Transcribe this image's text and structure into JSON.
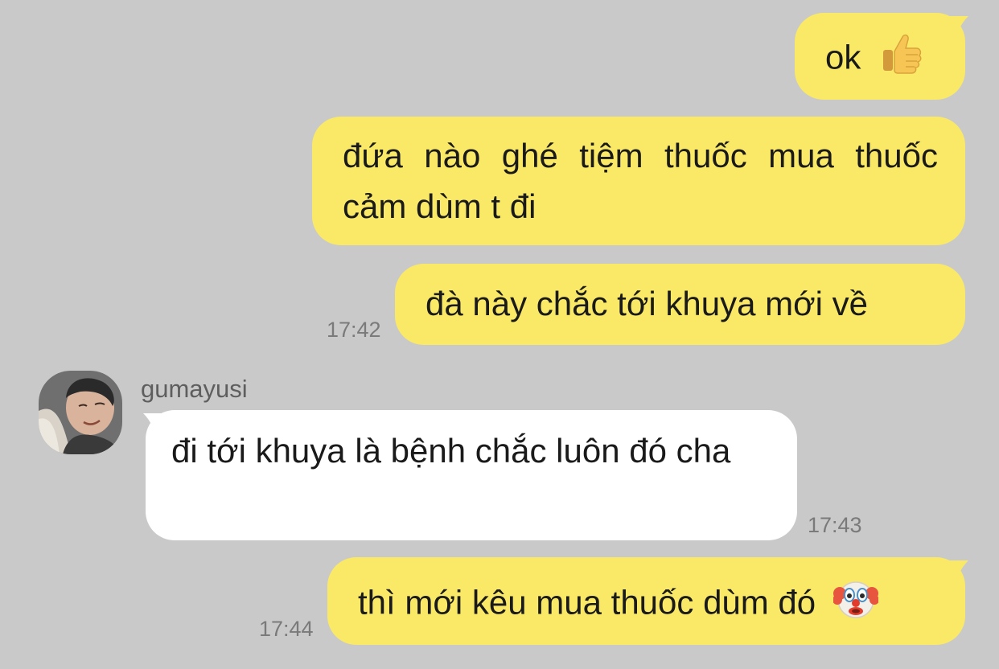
{
  "colors": {
    "background": "#c9c9c9",
    "outgoing_bubble": "#fae967",
    "incoming_bubble": "#ffffff",
    "timestamp": "#7a7a7a"
  },
  "messages": [
    {
      "direction": "outgoing",
      "text": "ok",
      "emoji": "thumbs-up-icon"
    },
    {
      "direction": "outgoing",
      "text": "đứa nào ghé tiệm thuốc mua thuốc cảm dùm t đi"
    },
    {
      "direction": "outgoing",
      "text": "đà này chắc tới khuya mới về",
      "time": "17:42"
    },
    {
      "direction": "incoming",
      "sender": "gumayusi",
      "avatar": "avatar",
      "text": "đi tới khuya là bệnh chắc luôn đó cha",
      "time": "17:43"
    },
    {
      "direction": "outgoing",
      "text": "thì mới kêu mua thuốc dùm đó",
      "emoji": "clown-face-icon",
      "time": "17:44"
    }
  ]
}
